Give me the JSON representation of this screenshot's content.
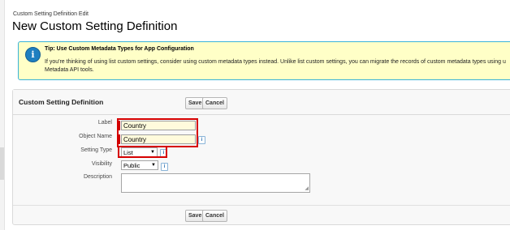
{
  "breadcrumb": "Custom Setting Definition Edit",
  "page_title": "New Custom Setting Definition",
  "tip": {
    "title": "Tip: Use Custom Metadata Types for App Configuration",
    "body": "If you're thinking of using list custom settings, consider using custom metadata types instead. Unlike list custom settings, you can migrate the records of custom metadata types using u Metadata API tools.",
    "icon": "info-icon"
  },
  "panel": {
    "title": "Custom Setting Definition",
    "save_label": "Save",
    "cancel_label": "Cancel"
  },
  "fields": {
    "label": {
      "label": "Label",
      "value": "Country"
    },
    "object_name": {
      "label": "Object Name",
      "value": "Country"
    },
    "setting_type": {
      "label": "Setting Type",
      "value": "List"
    },
    "visibility": {
      "label": "Visibility",
      "value": "Public"
    },
    "description": {
      "label": "Description",
      "value": ""
    }
  },
  "info_glyph": "i",
  "dropdown_glyph": "▼",
  "colors": {
    "highlight": "#d60000",
    "tip_background": "#ffffc7",
    "required": "#cc0000"
  }
}
